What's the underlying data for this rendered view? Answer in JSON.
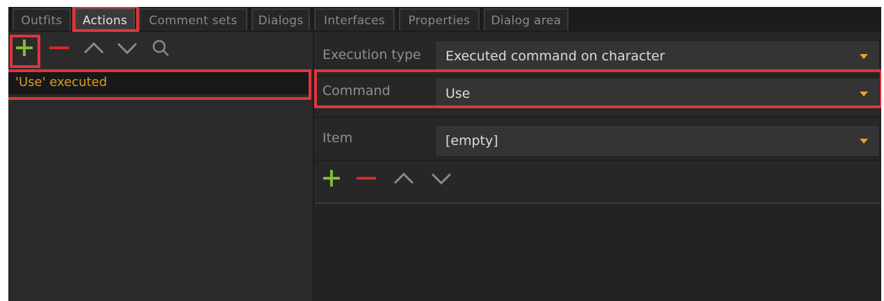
{
  "tabs": [
    {
      "label": "Outfits",
      "active": false
    },
    {
      "label": "Actions",
      "active": true
    },
    {
      "label": "Comment sets",
      "active": false
    },
    {
      "label": "Dialogs",
      "active": false
    },
    {
      "label": "Interfaces",
      "active": false
    },
    {
      "label": "Properties",
      "active": false
    },
    {
      "label": "Dialog area",
      "active": false
    }
  ],
  "left_toolbar": {
    "icons": [
      "add-icon",
      "remove-icon",
      "move-up-icon",
      "move-down-icon",
      "search-icon"
    ]
  },
  "actions_list": {
    "items": [
      {
        "label": "'Use' executed",
        "selected": true
      }
    ]
  },
  "properties": {
    "execution_type": {
      "label": "Execution type",
      "value": "Executed command on character"
    },
    "command": {
      "label": "Command",
      "value": "Use"
    },
    "item": {
      "label": "Item",
      "value": "[empty]"
    }
  },
  "condition_toolbar": {
    "icons": [
      "add-icon",
      "remove-icon",
      "move-up-icon",
      "move-down-icon"
    ]
  },
  "colors": {
    "add": "#7fba3a",
    "remove": "#d9262c",
    "arrow": "#8a8a8a",
    "selected_text": "#d69e23",
    "caret": "#e8a623",
    "highlight": "#e0353b"
  }
}
